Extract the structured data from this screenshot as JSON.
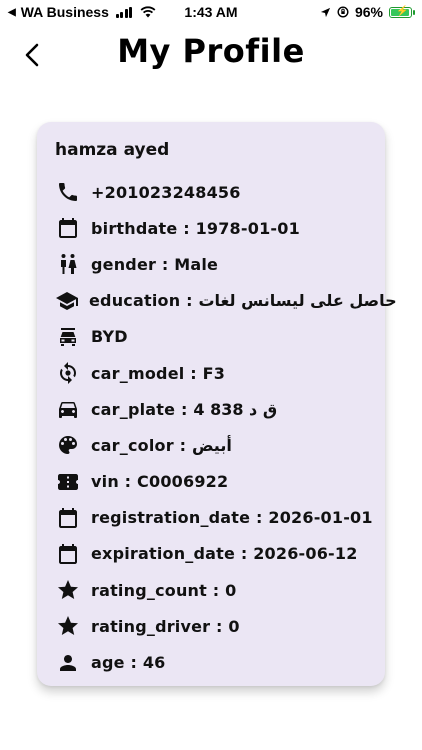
{
  "status_bar": {
    "carrier": "WA Business",
    "time": "1:43 AM",
    "battery": "96%"
  },
  "header": {
    "title": "My Profile"
  },
  "profile": {
    "name": "hamza ayed",
    "rows": [
      {
        "icon": "phone-icon",
        "label": "",
        "sep": "",
        "value": "+201023248456"
      },
      {
        "icon": "calendar-icon",
        "label": "birthdate",
        "sep": " : ",
        "value": "1978-01-01"
      },
      {
        "icon": "gender-icon",
        "label": "gender",
        "sep": " : ",
        "value": "Male"
      },
      {
        "icon": "graduation-cap-icon",
        "label": "education",
        "sep": " : ",
        "value": "حاصل على ليسانس لغات"
      },
      {
        "icon": "car-front-icon",
        "label": "",
        "sep": "",
        "value": "BYD"
      },
      {
        "icon": "car-model-icon",
        "label": "car_model",
        "sep": " : ",
        "value": "F3"
      },
      {
        "icon": "car-icon",
        "label": "car_plate",
        "sep": " : ",
        "value": "ق د 838 4"
      },
      {
        "icon": "palette-icon",
        "label": "car_color",
        "sep": " : ",
        "value": "أبيض"
      },
      {
        "icon": "ticket-icon",
        "label": "vin",
        "sep": " : ",
        "value": "C0006922"
      },
      {
        "icon": "calendar-icon",
        "label": "registration_date",
        "sep": " : ",
        "value": "2026-01-01"
      },
      {
        "icon": "calendar-icon",
        "label": "expiration_date",
        "sep": " : ",
        "value": "2026-06-12"
      },
      {
        "icon": "star-icon",
        "label": "rating_count",
        "sep": " : ",
        "value": "0"
      },
      {
        "icon": "star-icon",
        "label": "rating_driver",
        "sep": " : ",
        "value": "0"
      },
      {
        "icon": "person-icon",
        "label": "age",
        "sep": " : ",
        "value": "46"
      }
    ]
  }
}
